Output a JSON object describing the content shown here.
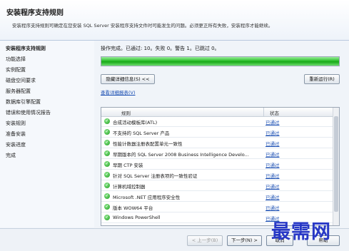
{
  "header": {
    "title": "安装程序支持规则",
    "description": "安装程序支持规则可确定在您安装 SQL Server 安装程序支持文件时可能发生的问题。必须更正所有失败，安装程序才能继续。"
  },
  "sidebar": {
    "items": [
      {
        "label": "安装程序支持规则",
        "active": true
      },
      {
        "label": "功能选择",
        "active": false
      },
      {
        "label": "实例配置",
        "active": false
      },
      {
        "label": "磁盘空间要求",
        "active": false
      },
      {
        "label": "服务器配置",
        "active": false
      },
      {
        "label": "数据库引擎配置",
        "active": false
      },
      {
        "label": "错误和使用情况报告",
        "active": false
      },
      {
        "label": "安装规则",
        "active": false
      },
      {
        "label": "准备安装",
        "active": false
      },
      {
        "label": "安装进度",
        "active": false
      },
      {
        "label": "完成",
        "active": false
      }
    ]
  },
  "main": {
    "status_text": "操作完成。已通过: 10。失败 0。警告 1。已跳过 0。",
    "progress_percent": 100,
    "progress_color": "#2bbf2b",
    "hide_details_label": "隐藏详细信息(S) <<",
    "rerun_label": "重新运行(R)",
    "view_report_label": "查看详细报表(V)",
    "table": {
      "columns": {
        "rule": "规则",
        "status": "状态"
      },
      "rows": [
        {
          "rule": "合成活动模板库(ATL)",
          "status": "已通过"
        },
        {
          "rule": "不支持的 SQL Server 产品",
          "status": "已通过"
        },
        {
          "rule": "性能计数器注册表配置单元一致性",
          "status": "已通过"
        },
        {
          "rule": "早期版本的 SQL Server 2008 Business Intelligence Develo...",
          "status": "已通过"
        },
        {
          "rule": "早期 CTP 安装",
          "status": "已通过"
        },
        {
          "rule": "针对 SQL Server 注册表项的一致性验证",
          "status": "已通过"
        },
        {
          "rule": "计算机域控制器",
          "status": "已通过"
        },
        {
          "rule": "Microsoft .NET 应用程序安全性",
          "status": "已通过"
        },
        {
          "rule": "版本 WOW64 平台",
          "status": "已通过"
        },
        {
          "rule": "Windows PowerShell",
          "status": "已通过"
        }
      ]
    }
  },
  "footer": {
    "back_label": "< 上一步(B)",
    "next_label": "下一步(N) >",
    "cancel_label": "取消",
    "help_label": "帮助"
  },
  "watermark": "最需网",
  "icons": {
    "pass": "check-circle-icon"
  }
}
